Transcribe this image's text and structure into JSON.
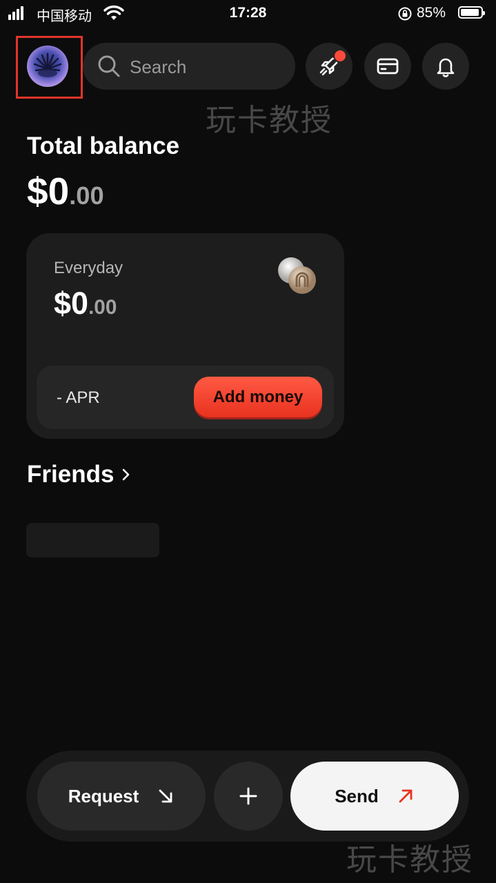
{
  "status_bar": {
    "carrier": "中国移动",
    "time": "17:28",
    "battery_percent": "85%"
  },
  "top_bar": {
    "search_placeholder": "Search",
    "icons": [
      "avatar",
      "rocket-icon",
      "card-icon",
      "bell-icon"
    ],
    "rocket_badge_color": "#ff4a3a",
    "highlight_color": "#e1352a"
  },
  "watermark": "玩卡教授",
  "balance": {
    "label": "Total balance",
    "dollars": "$0",
    "cents": ".00"
  },
  "account_card": {
    "name": "Everyday",
    "dollars": "$0",
    "cents": ".00",
    "apr": "- APR",
    "add_money_label": "Add money",
    "accent_color": "#ff4a36"
  },
  "friends": {
    "title": "Friends"
  },
  "actions": {
    "request_label": "Request",
    "send_label": "Send",
    "send_arrow_color": "#e8321f"
  }
}
